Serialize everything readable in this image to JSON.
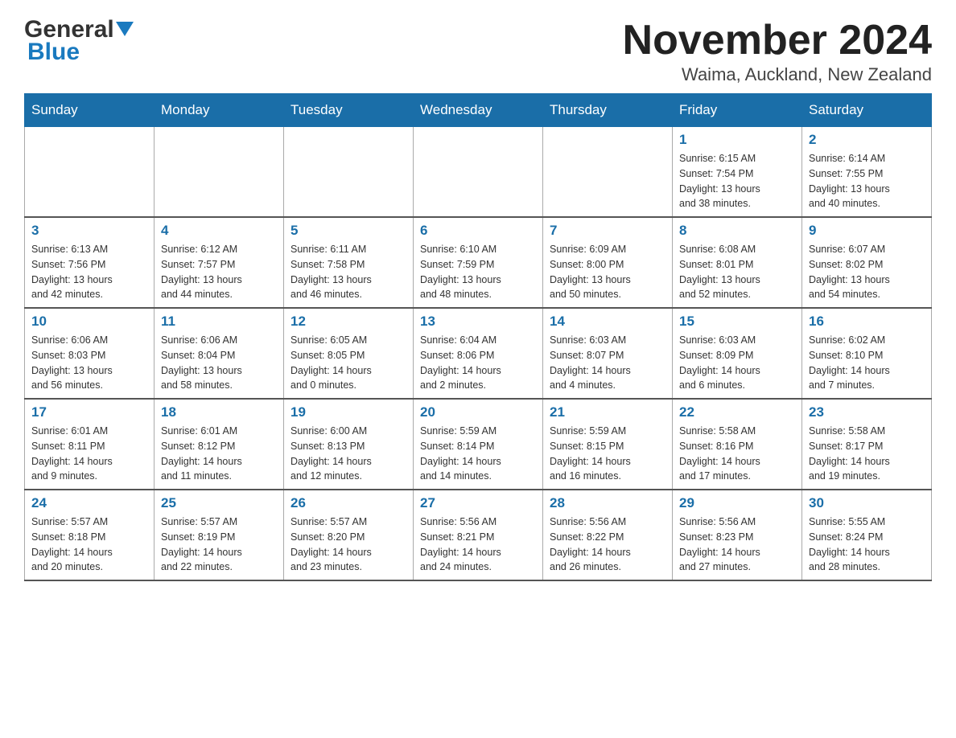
{
  "logo": {
    "general": "General",
    "blue": "Blue"
  },
  "title": "November 2024",
  "location": "Waima, Auckland, New Zealand",
  "weekdays": [
    "Sunday",
    "Monday",
    "Tuesday",
    "Wednesday",
    "Thursday",
    "Friday",
    "Saturday"
  ],
  "weeks": [
    [
      {
        "day": "",
        "info": ""
      },
      {
        "day": "",
        "info": ""
      },
      {
        "day": "",
        "info": ""
      },
      {
        "day": "",
        "info": ""
      },
      {
        "day": "",
        "info": ""
      },
      {
        "day": "1",
        "info": "Sunrise: 6:15 AM\nSunset: 7:54 PM\nDaylight: 13 hours\nand 38 minutes."
      },
      {
        "day": "2",
        "info": "Sunrise: 6:14 AM\nSunset: 7:55 PM\nDaylight: 13 hours\nand 40 minutes."
      }
    ],
    [
      {
        "day": "3",
        "info": "Sunrise: 6:13 AM\nSunset: 7:56 PM\nDaylight: 13 hours\nand 42 minutes."
      },
      {
        "day": "4",
        "info": "Sunrise: 6:12 AM\nSunset: 7:57 PM\nDaylight: 13 hours\nand 44 minutes."
      },
      {
        "day": "5",
        "info": "Sunrise: 6:11 AM\nSunset: 7:58 PM\nDaylight: 13 hours\nand 46 minutes."
      },
      {
        "day": "6",
        "info": "Sunrise: 6:10 AM\nSunset: 7:59 PM\nDaylight: 13 hours\nand 48 minutes."
      },
      {
        "day": "7",
        "info": "Sunrise: 6:09 AM\nSunset: 8:00 PM\nDaylight: 13 hours\nand 50 minutes."
      },
      {
        "day": "8",
        "info": "Sunrise: 6:08 AM\nSunset: 8:01 PM\nDaylight: 13 hours\nand 52 minutes."
      },
      {
        "day": "9",
        "info": "Sunrise: 6:07 AM\nSunset: 8:02 PM\nDaylight: 13 hours\nand 54 minutes."
      }
    ],
    [
      {
        "day": "10",
        "info": "Sunrise: 6:06 AM\nSunset: 8:03 PM\nDaylight: 13 hours\nand 56 minutes."
      },
      {
        "day": "11",
        "info": "Sunrise: 6:06 AM\nSunset: 8:04 PM\nDaylight: 13 hours\nand 58 minutes."
      },
      {
        "day": "12",
        "info": "Sunrise: 6:05 AM\nSunset: 8:05 PM\nDaylight: 14 hours\nand 0 minutes."
      },
      {
        "day": "13",
        "info": "Sunrise: 6:04 AM\nSunset: 8:06 PM\nDaylight: 14 hours\nand 2 minutes."
      },
      {
        "day": "14",
        "info": "Sunrise: 6:03 AM\nSunset: 8:07 PM\nDaylight: 14 hours\nand 4 minutes."
      },
      {
        "day": "15",
        "info": "Sunrise: 6:03 AM\nSunset: 8:09 PM\nDaylight: 14 hours\nand 6 minutes."
      },
      {
        "day": "16",
        "info": "Sunrise: 6:02 AM\nSunset: 8:10 PM\nDaylight: 14 hours\nand 7 minutes."
      }
    ],
    [
      {
        "day": "17",
        "info": "Sunrise: 6:01 AM\nSunset: 8:11 PM\nDaylight: 14 hours\nand 9 minutes."
      },
      {
        "day": "18",
        "info": "Sunrise: 6:01 AM\nSunset: 8:12 PM\nDaylight: 14 hours\nand 11 minutes."
      },
      {
        "day": "19",
        "info": "Sunrise: 6:00 AM\nSunset: 8:13 PM\nDaylight: 14 hours\nand 12 minutes."
      },
      {
        "day": "20",
        "info": "Sunrise: 5:59 AM\nSunset: 8:14 PM\nDaylight: 14 hours\nand 14 minutes."
      },
      {
        "day": "21",
        "info": "Sunrise: 5:59 AM\nSunset: 8:15 PM\nDaylight: 14 hours\nand 16 minutes."
      },
      {
        "day": "22",
        "info": "Sunrise: 5:58 AM\nSunset: 8:16 PM\nDaylight: 14 hours\nand 17 minutes."
      },
      {
        "day": "23",
        "info": "Sunrise: 5:58 AM\nSunset: 8:17 PM\nDaylight: 14 hours\nand 19 minutes."
      }
    ],
    [
      {
        "day": "24",
        "info": "Sunrise: 5:57 AM\nSunset: 8:18 PM\nDaylight: 14 hours\nand 20 minutes."
      },
      {
        "day": "25",
        "info": "Sunrise: 5:57 AM\nSunset: 8:19 PM\nDaylight: 14 hours\nand 22 minutes."
      },
      {
        "day": "26",
        "info": "Sunrise: 5:57 AM\nSunset: 8:20 PM\nDaylight: 14 hours\nand 23 minutes."
      },
      {
        "day": "27",
        "info": "Sunrise: 5:56 AM\nSunset: 8:21 PM\nDaylight: 14 hours\nand 24 minutes."
      },
      {
        "day": "28",
        "info": "Sunrise: 5:56 AM\nSunset: 8:22 PM\nDaylight: 14 hours\nand 26 minutes."
      },
      {
        "day": "29",
        "info": "Sunrise: 5:56 AM\nSunset: 8:23 PM\nDaylight: 14 hours\nand 27 minutes."
      },
      {
        "day": "30",
        "info": "Sunrise: 5:55 AM\nSunset: 8:24 PM\nDaylight: 14 hours\nand 28 minutes."
      }
    ]
  ]
}
